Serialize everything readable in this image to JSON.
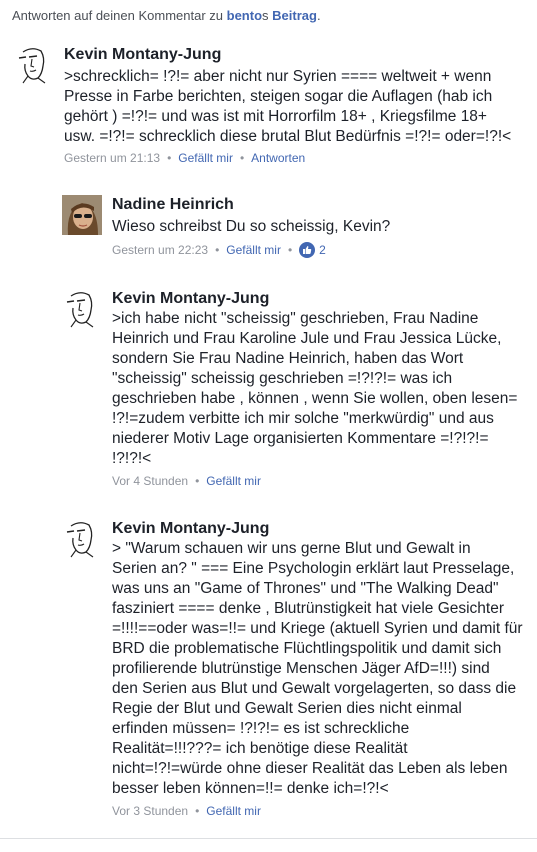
{
  "header": {
    "prefix": "Antworten auf deinen Kommentar zu ",
    "author_link": "bento",
    "possessive": "s ",
    "post_link": "Beitrag",
    "suffix": "."
  },
  "comments": [
    {
      "author": "Kevin Montany-Jung",
      "text": ">schrecklich= !?!= aber nicht nur Syrien ==== weltweit + wenn\nPresse in  Farbe berichten, steigen sogar die Auflagen (hab ich\ngehört ) =!?!= und was ist mit Horrorfilm 18+ , Kriegsfilme 18+\nusw. =!?!= schrecklich diese brutal Blut Bedürfnis =!?!= oder=!?!<",
      "time": "Gestern um 21:13",
      "like": "Gefällt mir",
      "reply": "Antworten"
    },
    {
      "author": "Nadine Heinrich",
      "text": "Wieso schreibst Du so scheissig, Kevin?",
      "time": "Gestern um 22:23",
      "like": "Gefällt mir",
      "likes_count": "2"
    },
    {
      "author": "Kevin Montany-Jung",
      "text": ">ich habe nicht \"scheissig\"  geschrieben, Frau Nadine\nHeinrich und Frau Karoline Jule und Frau Jessica Lücke,\nsondern Sie Frau Nadine Heinrich, haben das Wort\n\"scheissig\" scheissig  geschrieben =!?!?!= was ich\ngeschrieben habe , können , wenn Sie wollen, oben lesen=\n!?!=zudem  verbitte ich mir solche \"merkwürdig\" und aus\nniederer Motiv Lage organisierten Kommentare  =!?!?!=\n!?!?!<",
      "time": "Vor 4 Stunden",
      "like": "Gefällt mir"
    },
    {
      "author": "Kevin Montany-Jung",
      "text": "> \"Warum schauen wir uns gerne Blut und Gewalt in\nSerien an? \" === Eine Psychologin erklärt laut Presselage,\nwas uns an \"Game of Thrones\" und \"The Walking Dead\"\nfasziniert ==== denke , Blutrünstigkeit hat viele Gesichter\n=!!!!==oder was=!!=  und Kriege (aktuell Syrien und damit für\nBRD die problematische Flüchtlingspolitik und damit sich\nprofilierende blutrünstige  Menschen Jäger AfD=!!!)    sind\nden Serien aus Blut und Gewalt vorgelagerten, so dass die\nRegie der  Blut und Gewalt Serien dies nicht einmal\nerfinden müssen= !?!?!= es ist schreckliche\nRealität=!!!???=  ich benötige diese Realität\nnicht=!?!=würde ohne dieser Realität das Leben als leben\nbesser leben können=!!= denke ich=!?!<",
      "time": "Vor 3 Stunden",
      "like": "Gefällt mir"
    }
  ],
  "icons": {
    "avatar": "sketch-face-avatar",
    "like": "thumbs-up-icon"
  },
  "colors": {
    "link": "#4267b2",
    "meta": "#90949c",
    "text": "#1d2129"
  }
}
